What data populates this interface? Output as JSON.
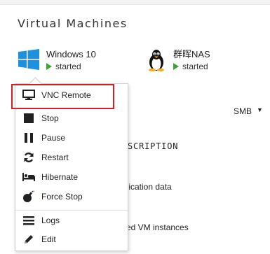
{
  "section": {
    "title": "Virtual Machines"
  },
  "vms": [
    {
      "name": "Windows 10",
      "status": "started",
      "icon": "windows-logo-icon"
    },
    {
      "name": "群晖NAS",
      "status": "started",
      "icon": "linux-tux-icon"
    }
  ],
  "background": {
    "smb": "SMB",
    "caret": "▼",
    "description_header": "ESCRIPTION",
    "app_data": "plication data",
    "saved_vm": "ved VM instances"
  },
  "menu": {
    "items": [
      {
        "label": "VNC Remote",
        "icon": "monitor-icon"
      },
      {
        "label": "Stop",
        "icon": "stop-icon"
      },
      {
        "label": "Pause",
        "icon": "pause-icon"
      },
      {
        "label": "Restart",
        "icon": "refresh-icon"
      },
      {
        "label": "Hibernate",
        "icon": "bed-icon"
      },
      {
        "label": "Force Stop",
        "icon": "bomb-icon"
      },
      {
        "label": "Logs",
        "icon": "list-icon"
      },
      {
        "label": "Edit",
        "icon": "pencil-icon"
      }
    ]
  },
  "colors": {
    "status_green": "#3aa435",
    "highlight_red": "#d62020",
    "windows_blue": "#1e90e0"
  }
}
